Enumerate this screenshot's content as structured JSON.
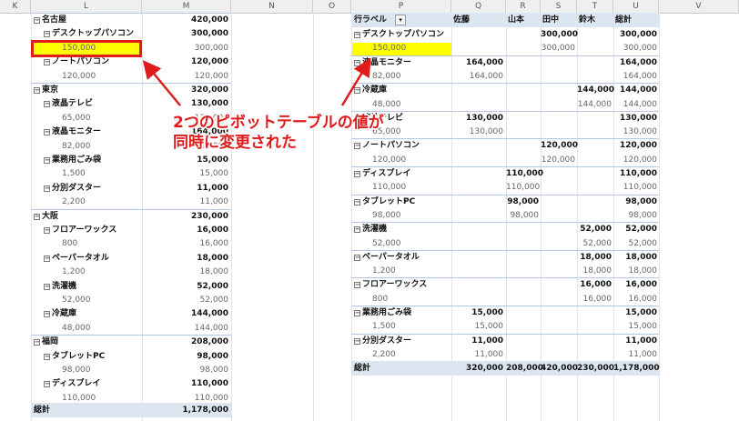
{
  "columns": [
    "K",
    "L",
    "M",
    "N",
    "O",
    "P",
    "Q",
    "R",
    "S",
    "T",
    "U",
    "V"
  ],
  "left": {
    "rows": [
      {
        "label": "名古屋",
        "value": "420,000",
        "level": 0
      },
      {
        "label": "デスクトップパソコン",
        "value": "300,000",
        "level": 1
      },
      {
        "label": "150,000",
        "value": "300,000",
        "level": 2
      },
      {
        "label": "ノートパソコン",
        "value": "120,000",
        "level": 1
      },
      {
        "label": "120,000",
        "value": "120,000",
        "level": 2
      },
      {
        "label": "東京",
        "value": "320,000",
        "level": 0
      },
      {
        "label": "液晶テレビ",
        "value": "130,000",
        "level": 1
      },
      {
        "label": "65,000",
        "value": "130,000",
        "level": 2
      },
      {
        "label": "液晶モニター",
        "value": "164,000",
        "level": 1
      },
      {
        "label": "82,000",
        "value": "164,000",
        "level": 2
      },
      {
        "label": "業務用ごみ袋",
        "value": "15,000",
        "level": 1
      },
      {
        "label": "1,500",
        "value": "15,000",
        "level": 2
      },
      {
        "label": "分別ダスター",
        "value": "11,000",
        "level": 1
      },
      {
        "label": "2,200",
        "value": "11,000",
        "level": 2
      },
      {
        "label": "大阪",
        "value": "230,000",
        "level": 0
      },
      {
        "label": "フロアーワックス",
        "value": "16,000",
        "level": 1
      },
      {
        "label": "800",
        "value": "16,000",
        "level": 2
      },
      {
        "label": "ペーパータオル",
        "value": "18,000",
        "level": 1
      },
      {
        "label": "1,200",
        "value": "18,000",
        "level": 2
      },
      {
        "label": "洗濯機",
        "value": "52,000",
        "level": 1
      },
      {
        "label": "52,000",
        "value": "52,000",
        "level": 2
      },
      {
        "label": "冷蔵庫",
        "value": "144,000",
        "level": 1
      },
      {
        "label": "48,000",
        "value": "144,000",
        "level": 2
      },
      {
        "label": "福岡",
        "value": "208,000",
        "level": 0
      },
      {
        "label": "タブレットPC",
        "value": "98,000",
        "level": 1
      },
      {
        "label": "98,000",
        "value": "98,000",
        "level": 2
      },
      {
        "label": "ディスプレイ",
        "value": "110,000",
        "level": 1
      },
      {
        "label": "110,000",
        "value": "110,000",
        "level": 2
      }
    ],
    "total_label": "総計",
    "total_value": "1,178,000"
  },
  "right": {
    "header": {
      "row_label": "行ラベル",
      "filter_icon": "▾",
      "names": [
        "佐藤",
        "山本",
        "田中",
        "鈴木",
        "総計"
      ]
    },
    "rows": [
      {
        "label": "デスクトップパソコン",
        "level": 1,
        "vals": [
          "",
          "",
          "300,000",
          "",
          "300,000"
        ]
      },
      {
        "label": "150,000",
        "level": 2,
        "vals": [
          "",
          "",
          "300,000",
          "",
          "300,000"
        ]
      },
      {
        "label": "液晶モニター",
        "level": 1,
        "vals": [
          "164,000",
          "",
          "",
          "",
          "164,000"
        ]
      },
      {
        "label": "82,000",
        "level": 2,
        "vals": [
          "164,000",
          "",
          "",
          "",
          "164,000"
        ]
      },
      {
        "label": "冷蔵庫",
        "level": 1,
        "vals": [
          "",
          "",
          "",
          "144,000",
          "144,000"
        ]
      },
      {
        "label": "48,000",
        "level": 2,
        "vals": [
          "",
          "",
          "",
          "144,000",
          "144,000"
        ]
      },
      {
        "label": "液晶テレビ",
        "level": 1,
        "vals": [
          "130,000",
          "",
          "",
          "",
          "130,000"
        ]
      },
      {
        "label": "65,000",
        "level": 2,
        "vals": [
          "130,000",
          "",
          "",
          "",
          "130,000"
        ]
      },
      {
        "label": "ノートパソコン",
        "level": 1,
        "vals": [
          "",
          "",
          "120,000",
          "",
          "120,000"
        ]
      },
      {
        "label": "120,000",
        "level": 2,
        "vals": [
          "",
          "",
          "120,000",
          "",
          "120,000"
        ]
      },
      {
        "label": "ディスプレイ",
        "level": 1,
        "vals": [
          "",
          "110,000",
          "",
          "",
          "110,000"
        ]
      },
      {
        "label": "110,000",
        "level": 2,
        "vals": [
          "",
          "110,000",
          "",
          "",
          "110,000"
        ]
      },
      {
        "label": "タブレットPC",
        "level": 1,
        "vals": [
          "",
          "98,000",
          "",
          "",
          "98,000"
        ]
      },
      {
        "label": "98,000",
        "level": 2,
        "vals": [
          "",
          "98,000",
          "",
          "",
          "98,000"
        ]
      },
      {
        "label": "洗濯機",
        "level": 1,
        "vals": [
          "",
          "",
          "",
          "52,000",
          "52,000"
        ]
      },
      {
        "label": "52,000",
        "level": 2,
        "vals": [
          "",
          "",
          "",
          "52,000",
          "52,000"
        ]
      },
      {
        "label": "ペーパータオル",
        "level": 1,
        "vals": [
          "",
          "",
          "",
          "18,000",
          "18,000"
        ]
      },
      {
        "label": "1,200",
        "level": 2,
        "vals": [
          "",
          "",
          "",
          "18,000",
          "18,000"
        ]
      },
      {
        "label": "フロアーワックス",
        "level": 1,
        "vals": [
          "",
          "",
          "",
          "16,000",
          "16,000"
        ]
      },
      {
        "label": "800",
        "level": 2,
        "vals": [
          "",
          "",
          "",
          "16,000",
          "16,000"
        ]
      },
      {
        "label": "業務用ごみ袋",
        "level": 1,
        "vals": [
          "15,000",
          "",
          "",
          "",
          "15,000"
        ]
      },
      {
        "label": "1,500",
        "level": 2,
        "vals": [
          "15,000",
          "",
          "",
          "",
          "15,000"
        ]
      },
      {
        "label": "分別ダスター",
        "level": 1,
        "vals": [
          "11,000",
          "",
          "",
          "",
          "11,000"
        ]
      },
      {
        "label": "2,200",
        "level": 2,
        "vals": [
          "11,000",
          "",
          "",
          "",
          "11,000"
        ]
      }
    ],
    "total_label": "総計",
    "totals": [
      "320,000",
      "208,000",
      "420,000",
      "230,000",
      "1,178,000"
    ]
  },
  "annotation": {
    "line1": "2つのピボットテーブルの値が",
    "line2": "同時に変更された"
  },
  "colors": {
    "highlight": "#ffff00",
    "highlight_border": "#e01b1b",
    "annotation": "#e01b1b",
    "band": "#dce6f1"
  }
}
